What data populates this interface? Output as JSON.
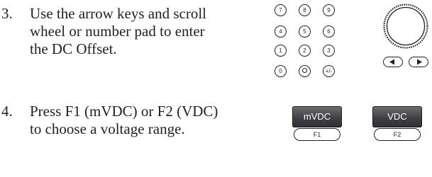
{
  "steps": [
    {
      "number": "3.",
      "lines": [
        "Use the arrow keys and scroll",
        "wheel or number pad to enter",
        "the DC Offset."
      ]
    },
    {
      "number": "4.",
      "lines": [
        "Press F1 (mVDC) or F2 (VDC)",
        "to choose a voltage range."
      ]
    }
  ],
  "keypad": {
    "row1": [
      "7",
      "8",
      "9"
    ],
    "row2": [
      "4",
      "5",
      "6"
    ],
    "row3": [
      "1",
      "2",
      "3"
    ],
    "row4": [
      "0",
      "",
      "+/-"
    ]
  },
  "softkeys": [
    {
      "label": "mVDC",
      "fkey": "F1"
    },
    {
      "label": "VDC",
      "fkey": "F2"
    }
  ],
  "icons": {
    "knob": "scroll-wheel-icon",
    "arrows": [
      "left-arrow-key-icon",
      "right-arrow-key-icon"
    ],
    "decimal": "decimal-point-key-icon"
  }
}
